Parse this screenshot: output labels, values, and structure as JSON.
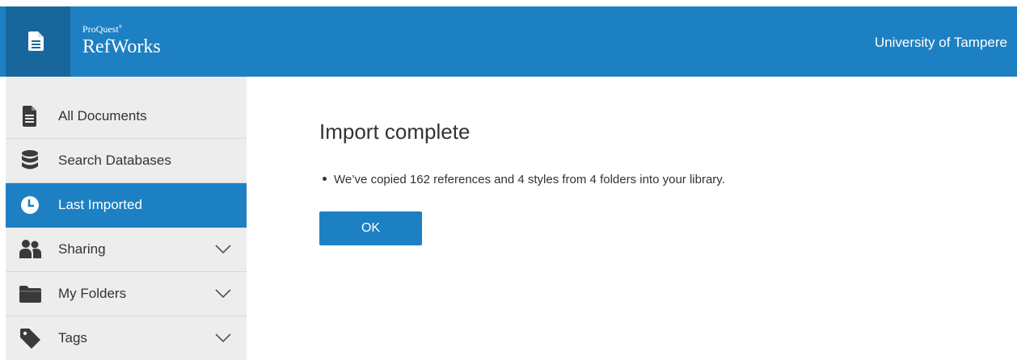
{
  "header": {
    "brand_small": "ProQuest",
    "brand_small_mark": "®",
    "brand_name": "RefWorks",
    "institution": "University of Tampere",
    "app_icon": "document-icon"
  },
  "sidebar": {
    "items": [
      {
        "label": "All Documents",
        "icon": "document-icon",
        "active": false,
        "expandable": false
      },
      {
        "label": "Search Databases",
        "icon": "database-icon",
        "active": false,
        "expandable": false
      },
      {
        "label": "Last Imported",
        "icon": "clock-icon",
        "active": true,
        "expandable": false
      },
      {
        "label": "Sharing",
        "icon": "users-icon",
        "active": false,
        "expandable": true
      },
      {
        "label": "My Folders",
        "icon": "folder-icon",
        "active": false,
        "expandable": true
      },
      {
        "label": "Tags",
        "icon": "tag-icon",
        "active": false,
        "expandable": true
      }
    ]
  },
  "main": {
    "title": "Import complete",
    "message": "We’ve copied 162 references and 4 styles from 4 folders into your library.",
    "ok_label": "OK"
  },
  "colors": {
    "accent": "#1d80c3",
    "accent_dark": "#17679d",
    "sidebar_bg": "#ededed",
    "text": "#333333"
  }
}
